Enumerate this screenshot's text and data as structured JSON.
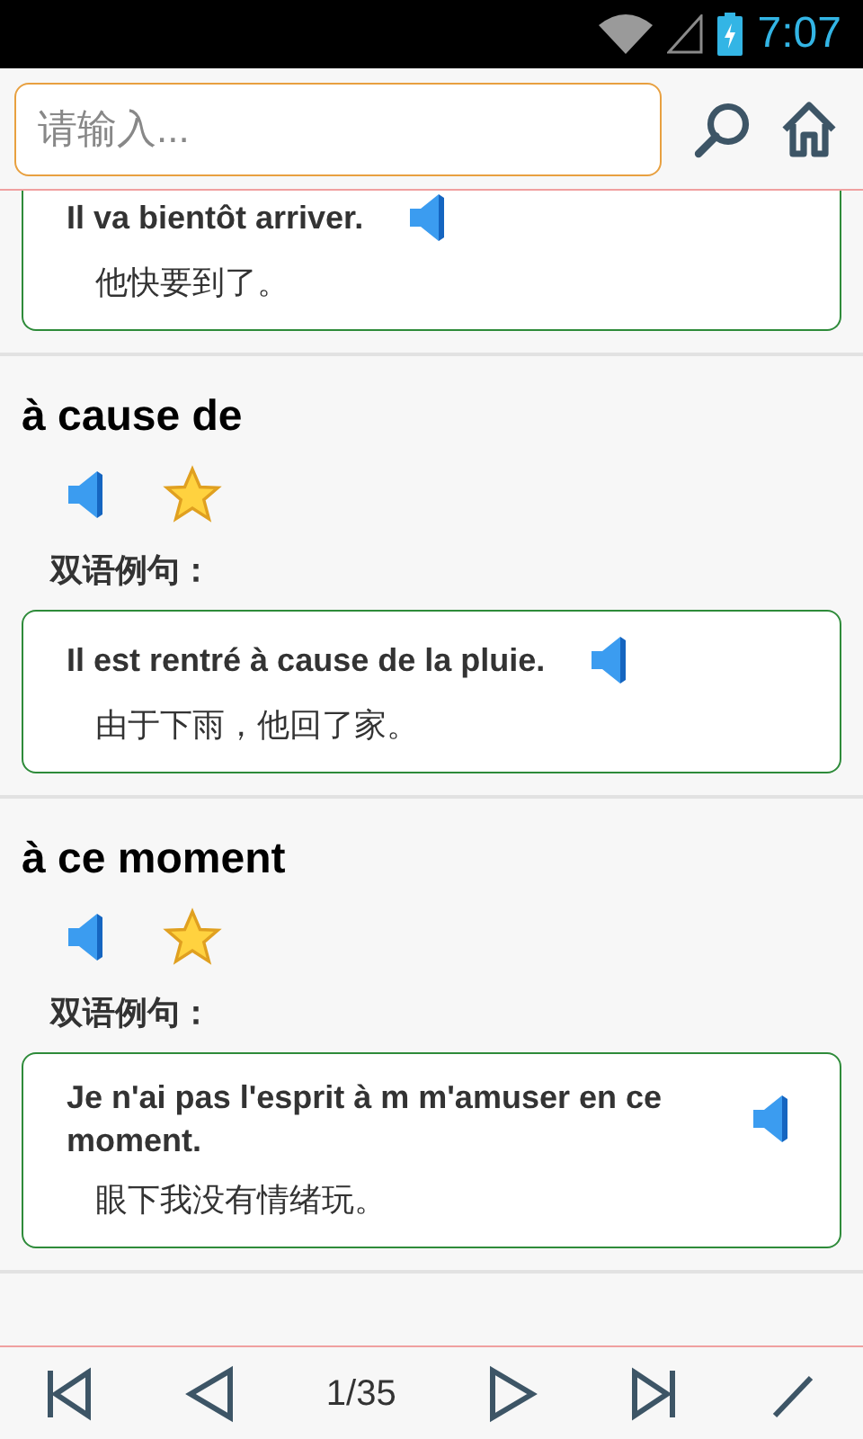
{
  "status_bar": {
    "time": "7:07"
  },
  "search": {
    "placeholder": "请输入..."
  },
  "partial_example": {
    "fr": "Il va bientôt arriver.",
    "zh": "他快要到了。"
  },
  "entries": [
    {
      "word": "à cause de",
      "starred": true,
      "examples_label": "双语例句：",
      "examples": [
        {
          "fr": "Il est rentré à cause de la pluie.",
          "zh": "由于下雨，他回了家。"
        }
      ]
    },
    {
      "word": "à ce moment",
      "starred": true,
      "examples_label": "双语例句：",
      "examples": [
        {
          "fr": "Je n'ai pas l'esprit à m m'amuser en ce moment.",
          "zh": "眼下我没有情绪玩。"
        }
      ]
    }
  ],
  "pager": {
    "page": "1/35"
  }
}
